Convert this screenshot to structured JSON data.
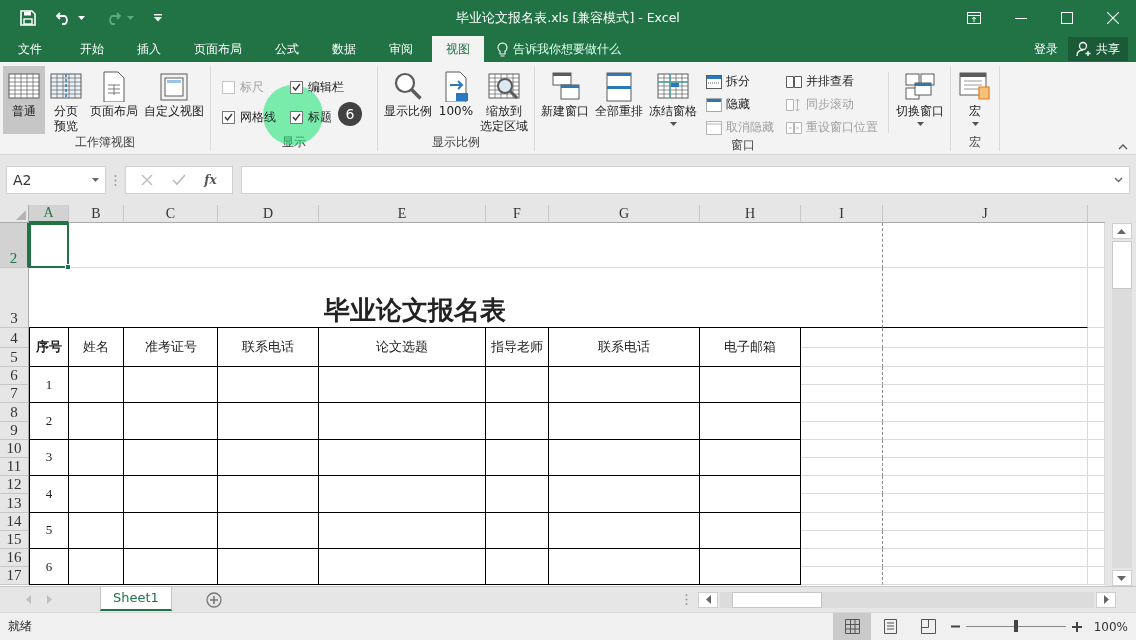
{
  "title_bar": {
    "quick_access": [
      {
        "kind": "save",
        "disabled": false
      },
      {
        "kind": "undo",
        "disabled": false
      },
      {
        "kind": "redo",
        "disabled": true
      },
      {
        "kind": "customize",
        "disabled": false
      }
    ],
    "title": "毕业论文报名表.xls [兼容模式] - Excel"
  },
  "tabs": [
    {
      "label": "文件",
      "selected": false
    },
    {
      "label": "开始",
      "selected": false
    },
    {
      "label": "插入",
      "selected": false
    },
    {
      "label": "页面布局",
      "selected": false
    },
    {
      "label": "公式",
      "selected": false
    },
    {
      "label": "数据",
      "selected": false
    },
    {
      "label": "审阅",
      "selected": false
    },
    {
      "label": "视图",
      "selected": true
    }
  ],
  "tell_me": "告诉我你想要做什么",
  "account": {
    "login": "登录",
    "share": "共享"
  },
  "ribbon": {
    "groups": [
      {
        "label": "工作簿视图",
        "items": [
          {
            "kind": "large",
            "lines": [
              "普通"
            ],
            "selected": true,
            "dropdown": false
          },
          {
            "kind": "large",
            "lines": [
              "分页",
              "预览"
            ],
            "selected": false,
            "dropdown": false
          },
          {
            "kind": "large",
            "lines": [
              "页面布局"
            ],
            "selected": false,
            "dropdown": false
          },
          {
            "kind": "large",
            "lines": [
              "自定义视图"
            ],
            "selected": false,
            "dropdown": false
          }
        ]
      },
      {
        "label": "显示",
        "items": [
          {
            "kind": "checks",
            "items": [
              {
                "label": "标尺",
                "checked": false,
                "disabled": true
              },
              {
                "label": "编辑栏",
                "checked": true,
                "disabled": false
              },
              {
                "label": "网格线",
                "checked": true,
                "disabled": false
              },
              {
                "label": "标题",
                "checked": true,
                "disabled": false
              }
            ]
          }
        ]
      },
      {
        "label": "显示比例",
        "items": [
          {
            "kind": "large",
            "lines": [
              "显示比例"
            ],
            "selected": false,
            "dropdown": false
          },
          {
            "kind": "large",
            "lines": [
              "100%"
            ],
            "selected": false,
            "dropdown": false
          },
          {
            "kind": "large",
            "lines": [
              "缩放到",
              "选定区域"
            ],
            "selected": false,
            "dropdown": false
          }
        ]
      },
      {
        "label": "窗口",
        "items": [
          {
            "kind": "large",
            "lines": [
              "新建窗口"
            ],
            "selected": false,
            "dropdown": false
          },
          {
            "kind": "large",
            "lines": [
              "全部重排"
            ],
            "selected": false,
            "dropdown": false
          },
          {
            "kind": "large",
            "lines": [
              "冻结窗格"
            ],
            "selected": false,
            "dropdown": true
          },
          {
            "kind": "stack",
            "items": [
              {
                "label": "拆分",
                "disabled": false
              },
              {
                "label": "隐藏",
                "disabled": false
              },
              {
                "label": "取消隐藏",
                "disabled": true
              }
            ]
          },
          {
            "kind": "stack",
            "items": [
              {
                "label": "并排查看",
                "disabled": false
              },
              {
                "label": "同步滚动",
                "disabled": true
              },
              {
                "label": "重设窗口位置",
                "disabled": true
              }
            ]
          },
          {
            "kind": "large",
            "lines": [
              "切换窗口"
            ],
            "selected": false,
            "dropdown": true
          }
        ]
      },
      {
        "label": "宏",
        "items": [
          {
            "kind": "large",
            "lines": [
              "宏"
            ],
            "selected": false,
            "dropdown": true
          }
        ]
      }
    ]
  },
  "tutorial_marker": {
    "step": "6"
  },
  "formula_bar": {
    "name_box": "A2",
    "function_label": "fx"
  },
  "sheet": {
    "columns": [
      {
        "label": "A",
        "selected": true
      },
      {
        "label": "B",
        "selected": false
      },
      {
        "label": "C",
        "selected": false
      },
      {
        "label": "D",
        "selected": false
      },
      {
        "label": "E",
        "selected": false
      },
      {
        "label": "F",
        "selected": false
      },
      {
        "label": "G",
        "selected": false
      },
      {
        "label": "H",
        "selected": false
      },
      {
        "label": "I",
        "selected": false
      },
      {
        "label": "J",
        "selected": false
      }
    ],
    "rows": [
      {
        "label": "2",
        "selected": true
      },
      {
        "label": "3",
        "selected": false
      },
      {
        "label": "4",
        "selected": false
      },
      {
        "label": "5",
        "selected": false
      },
      {
        "label": "6",
        "selected": false
      },
      {
        "label": "7",
        "selected": false
      },
      {
        "label": "8",
        "selected": false
      },
      {
        "label": "9",
        "selected": false
      },
      {
        "label": "10",
        "selected": false
      },
      {
        "label": "11",
        "selected": false
      },
      {
        "label": "12",
        "selected": false
      },
      {
        "label": "13",
        "selected": false
      },
      {
        "label": "14",
        "selected": false
      },
      {
        "label": "15",
        "selected": false
      },
      {
        "label": "16",
        "selected": false
      },
      {
        "label": "17",
        "selected": false
      }
    ],
    "table": {
      "title": "毕业论文报名表",
      "headers": [
        {
          "text": "序号",
          "bold": true
        },
        {
          "text": "姓名",
          "bold": false
        },
        {
          "text": "准考证号",
          "bold": false
        },
        {
          "text": "联系电话",
          "bold": false
        },
        {
          "text": "论文选题",
          "bold": false
        },
        {
          "text": "指导老师",
          "bold": false
        },
        {
          "text": "联系电话",
          "bold": false
        },
        {
          "text": "电子邮箱",
          "bold": false
        }
      ],
      "rows": [
        [
          "1"
        ],
        [
          "2"
        ],
        [
          "3"
        ],
        [
          "4"
        ],
        [
          "5"
        ],
        [
          "6"
        ]
      ]
    }
  },
  "sheet_tabs": [
    {
      "label": "Sheet1",
      "selected": true
    }
  ],
  "status_bar": {
    "status": "就绪",
    "views": [
      {
        "kind": "normal",
        "selected": true
      },
      {
        "kind": "page_layout",
        "selected": false
      },
      {
        "kind": "page_break",
        "selected": false
      }
    ],
    "zoom": {
      "level": 0.5,
      "reading": "100%"
    }
  }
}
